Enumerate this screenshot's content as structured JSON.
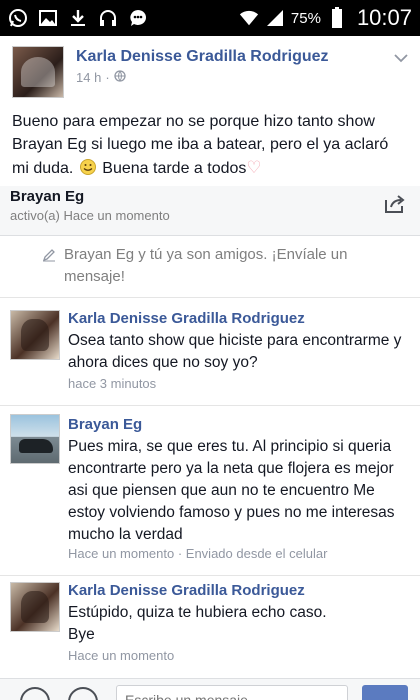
{
  "status_bar": {
    "battery_percent": "75%",
    "time": "10:07",
    "icons": [
      "whatsapp-icon",
      "gallery-icon",
      "download-icon",
      "headphones-icon",
      "messenger-icon",
      "wifi-icon",
      "signal-icon",
      "battery-icon"
    ]
  },
  "post": {
    "author": "Karla Denisse Gradilla Rodriguez",
    "time": "14 h",
    "separator": "·",
    "text_before_emoji": "Bueno para empezar no se porque hizo tanto show Brayan Eg si luego me iba a batear, pero el ya aclaró mi duda.",
    "text_after_emoji": "Buena tarde a todos",
    "heart": "♡"
  },
  "chat": {
    "name": "Brayan Eg",
    "status": "activo(a) Hace un momento",
    "friends_notice": "Brayan Eg y tú ya son amigos. ¡Envíale un mensaje!"
  },
  "messages": [
    {
      "sender": "Karla Denisse Gradilla Rodriguez",
      "body": "Osea tanto show que hiciste para encontrarme y ahora dices que no soy yo?",
      "time": "hace 3 minutos"
    },
    {
      "sender": "Brayan Eg",
      "body": "Pues mira, se que eres tu. Al principio si queria encontrarte pero ya la neta que flojera es mejor asi que piensen que aun no te encuentro Me estoy volviendo famoso y pues no me interesas mucho la verdad",
      "time": "Hace un momento · Enviado desde el celular"
    },
    {
      "sender": "Karla Denisse Gradilla Rodriguez",
      "body_line1": "Estúpido, quiza te hubiera echo caso.",
      "body_line2": "Bye",
      "time": "Hace un momento"
    }
  ],
  "composer": {
    "placeholder": "Escribe un mensaje..."
  },
  "colors": {
    "link_blue": "#3b5998",
    "meta_gray": "#9197a3",
    "header_bg": "#f6f7f8"
  }
}
